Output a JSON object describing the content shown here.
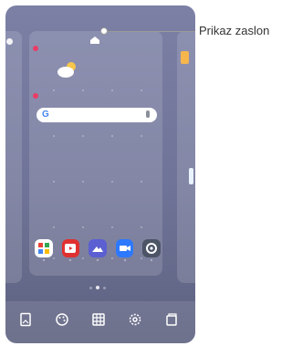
{
  "callout": {
    "label": "Prikaz zaslon"
  },
  "search": {
    "provider_letter": "G"
  },
  "icons": {
    "home": "home-icon",
    "weather": "weather-cloud-sun-icon",
    "search_mic": "microphone-icon",
    "dock": [
      "wallpaper-icon",
      "themes-icon",
      "widgets-icon",
      "settings-icon",
      "pages-icon"
    ]
  },
  "apps": [
    {
      "name": "photos-app-icon",
      "color": "#ffffff"
    },
    {
      "name": "youtube-app-icon",
      "color": "#e03131"
    },
    {
      "name": "gallery-app-icon",
      "color": "#5b5fd2"
    },
    {
      "name": "video-call-app-icon",
      "color": "#2c79ff"
    },
    {
      "name": "settings-app-icon",
      "color": "#4c5566"
    }
  ],
  "page_indicator": {
    "count": 3,
    "active": 1
  }
}
